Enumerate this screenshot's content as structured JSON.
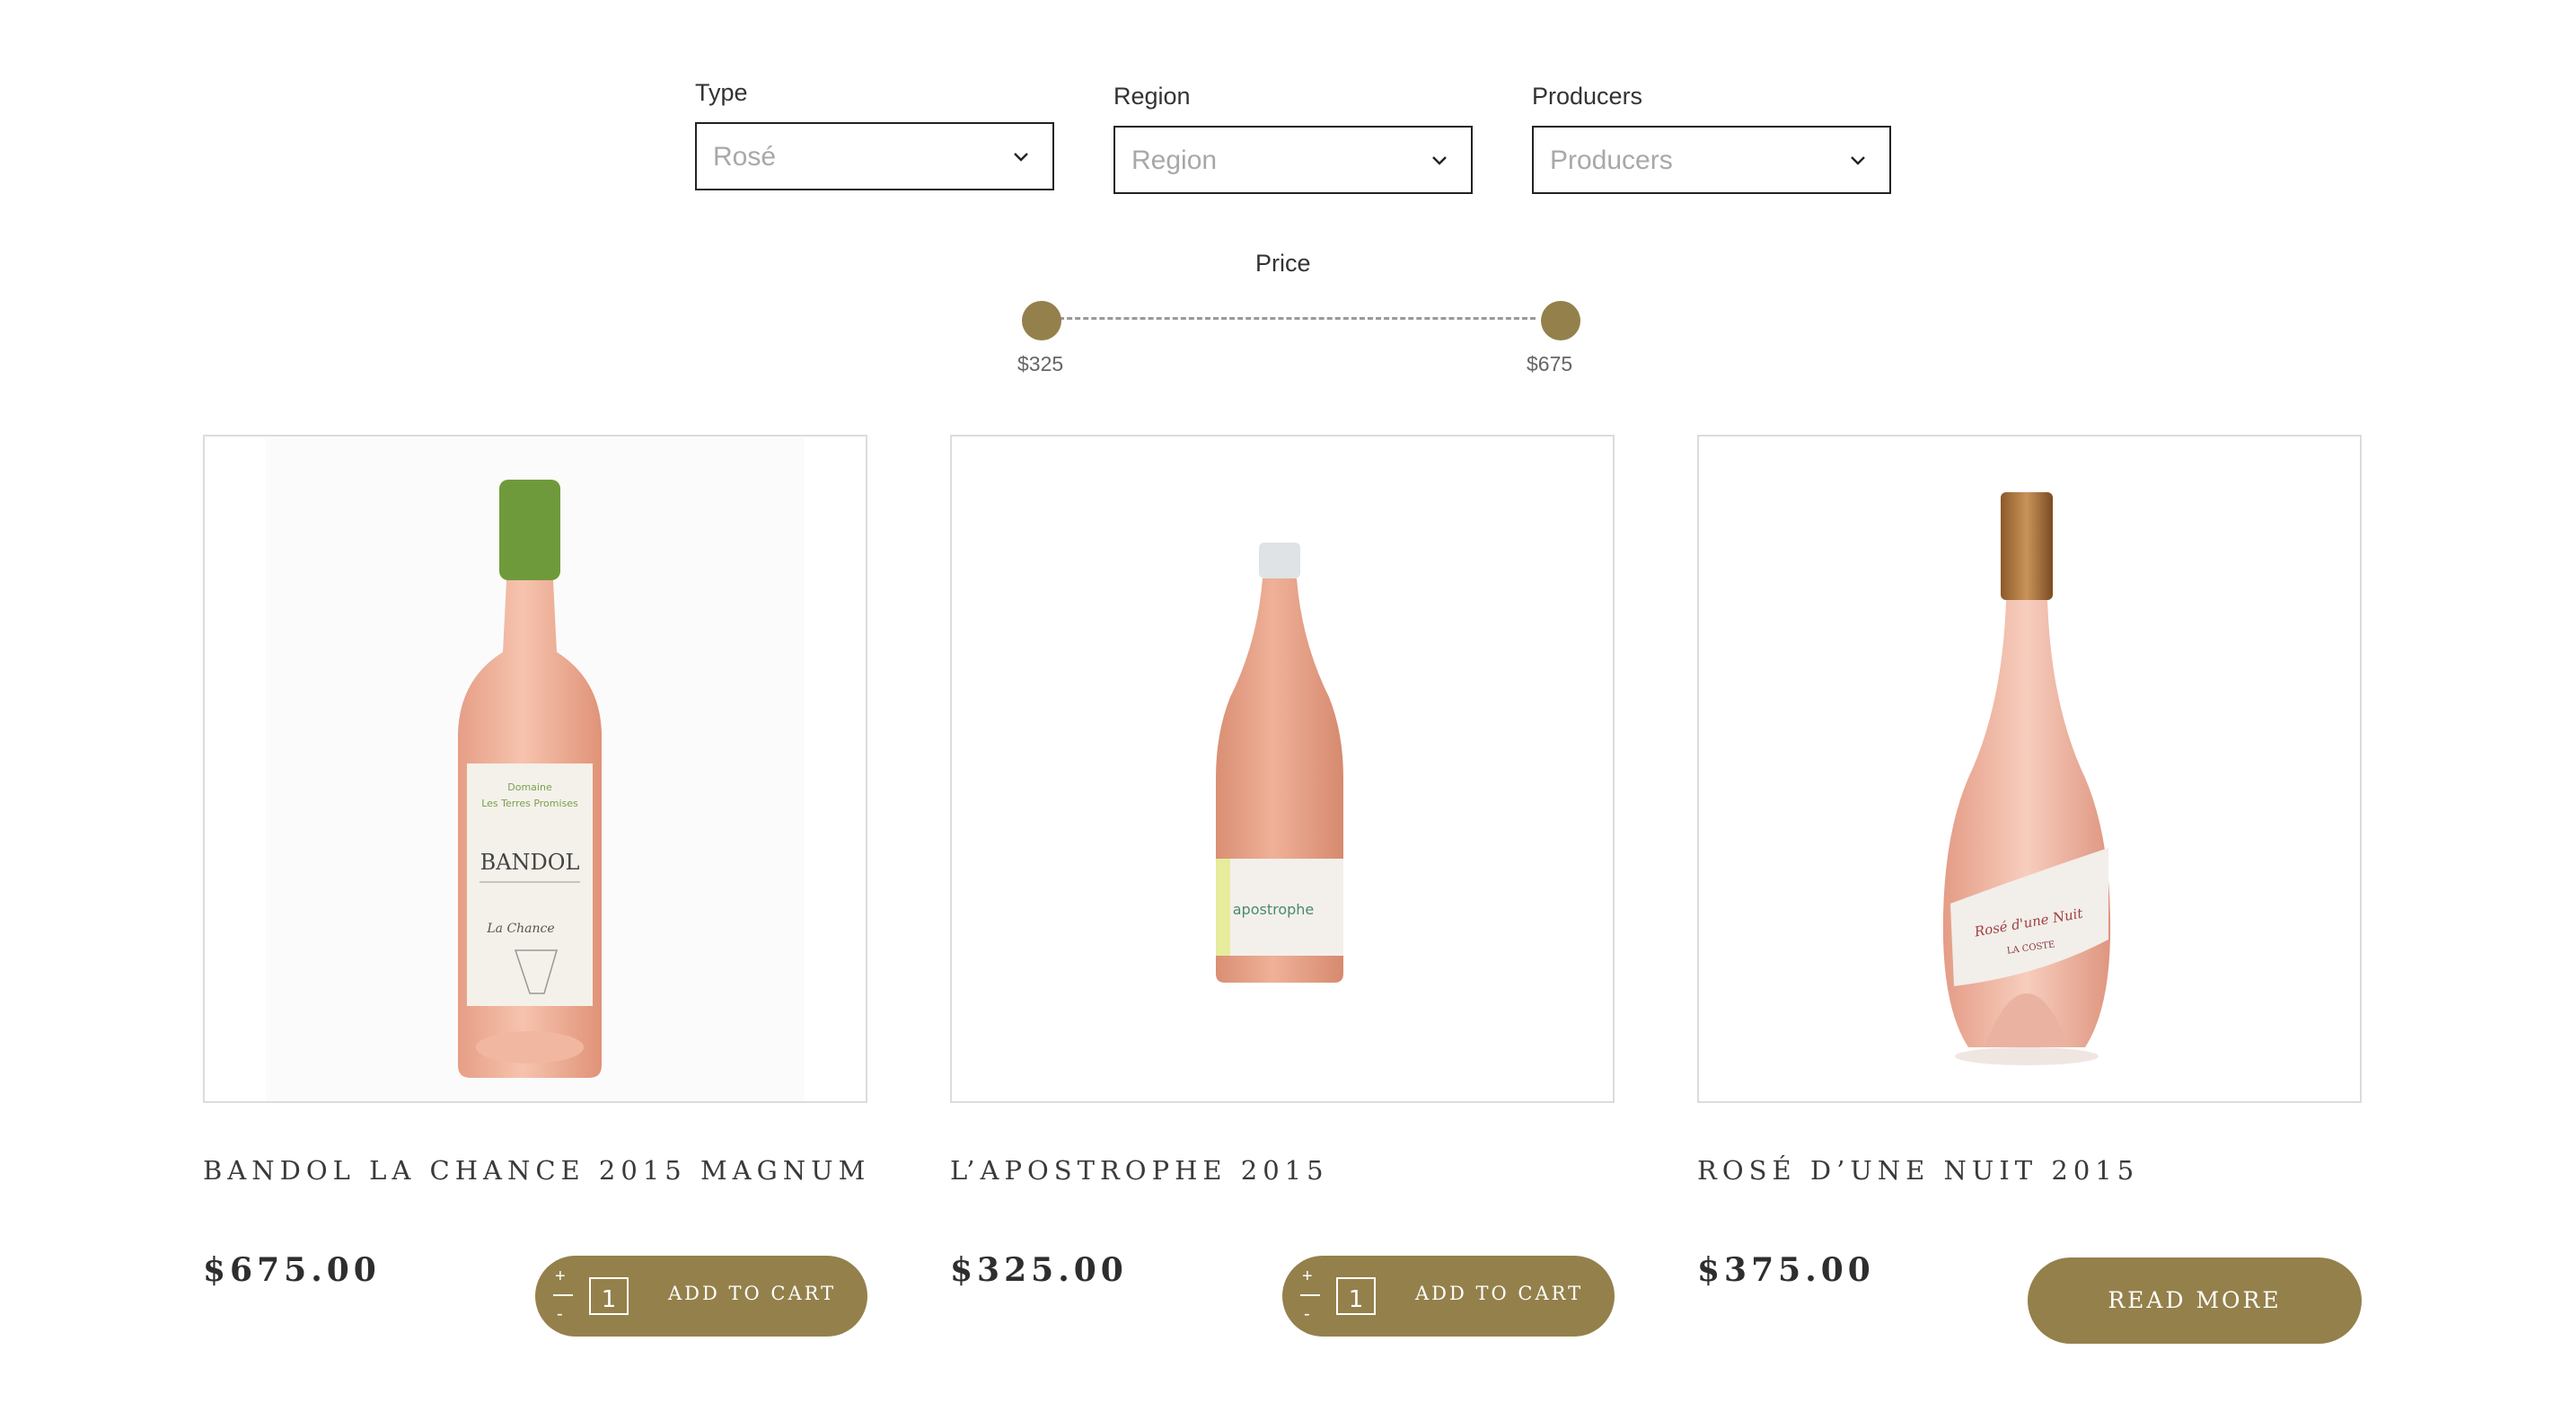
{
  "filters": {
    "type": {
      "label": "Type",
      "value": "Rosé"
    },
    "region": {
      "label": "Region",
      "value": "Region"
    },
    "producers": {
      "label": "Producers",
      "value": "Producers"
    }
  },
  "price": {
    "label": "Price",
    "min_label": "$325",
    "max_label": "$675",
    "min": 325,
    "max": 675
  },
  "products": [
    {
      "name": "BANDOL LA CHANCE 2015 MAGNUM",
      "price": "$675.00",
      "action": "ADD TO CART",
      "qty": "1",
      "bottle_label": {
        "line1": "Domaine",
        "line2": "Les Terres Promises",
        "line3": "BANDOL",
        "line4": "La Chance"
      }
    },
    {
      "name": "L’APOSTROPHE 2015",
      "price": "$325.00",
      "action": "ADD TO CART",
      "qty": "1",
      "bottle_label": {
        "line1": "apostrophe"
      }
    },
    {
      "name": "ROSÉ D’UNE NUIT 2015",
      "price": "$375.00",
      "action": "READ MORE",
      "bottle_label": {
        "line1": "Rosé d'une Nuit",
        "line2": "LA COSTE"
      }
    }
  ],
  "colors": {
    "accent": "#94804b",
    "wine_rose": "#f0b39c",
    "border": "#dcdcdc"
  }
}
